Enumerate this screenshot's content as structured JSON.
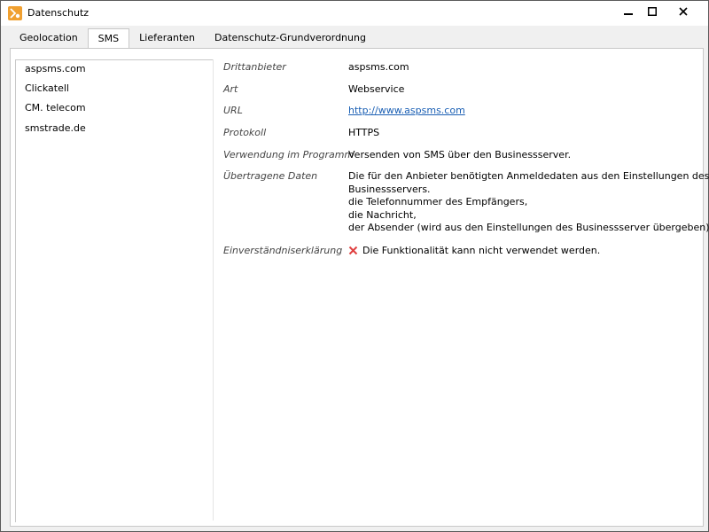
{
  "window": {
    "title": "Datenschutz"
  },
  "tabs": [
    {
      "label": "Geolocation",
      "active": false
    },
    {
      "label": "SMS",
      "active": true
    },
    {
      "label": "Lieferanten",
      "active": false
    },
    {
      "label": "Datenschutz-Grundverordnung",
      "active": false
    }
  ],
  "providers": [
    {
      "label": "aspsms.com",
      "selected": true
    },
    {
      "label": "Clickatell",
      "selected": false
    },
    {
      "label": "CM. telecom",
      "selected": false
    },
    {
      "label": "smstrade.de",
      "selected": false
    }
  ],
  "details": {
    "drittanbieter": {
      "label": "Drittanbieter",
      "value": "aspsms.com"
    },
    "art": {
      "label": "Art",
      "value": "Webservice"
    },
    "url": {
      "label": "URL",
      "value": "http://www.aspsms.com"
    },
    "protokoll": {
      "label": "Protokoll",
      "value": "HTTPS"
    },
    "verwendung": {
      "label": "Verwendung im Programm",
      "value": "Versenden von SMS über den Businessserver."
    },
    "daten": {
      "label": "Übertragene Daten",
      "lines": [
        "Die für den Anbieter benötigten Anmeldedaten aus den Einstellungen des",
        "Businessservers.",
        "die Telefonnummer des Empfängers,",
        "die Nachricht,",
        "der Absender (wird aus den Einstellungen des Businessserver übergeben)"
      ]
    },
    "einverstaendnis": {
      "label": "Einverständniserklärung",
      "value": "Die Funktionalität kann nicht verwendet werden.",
      "icon": "error-x-icon",
      "icon_color": "#e04040"
    }
  },
  "colors": {
    "app_icon": "#f0a030",
    "link": "#1a5fb4"
  }
}
